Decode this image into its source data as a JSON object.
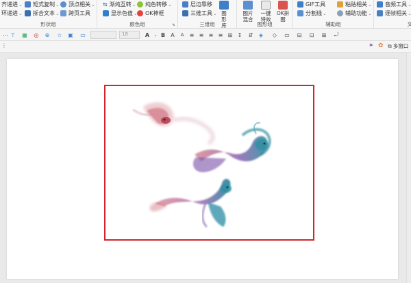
{
  "ribbon": {
    "shape_group": {
      "label": "形状组",
      "items": [
        "齐递进",
        "矩式复制",
        "顶点相关",
        "环递进",
        "拆合文本",
        "跨页工具"
      ]
    },
    "color_group": {
      "label": "颜色组",
      "items": [
        "渐纯互转",
        "纯色转移",
        "显示色值",
        "OK神框"
      ]
    },
    "threed_group": {
      "label": "三维组",
      "items": [
        "层边靠移",
        "三维工具"
      ],
      "big_button": "图形库"
    },
    "graphic_group": {
      "label": "图形组",
      "buttons": [
        "图片混合",
        "一键特效",
        "OK拼图"
      ]
    },
    "assist_group": {
      "label": "辅助组",
      "items": [
        "GIF工具",
        "粘贴相关",
        "分割线",
        "辅助功能"
      ]
    },
    "text_group": {
      "label": "文",
      "items": [
        "音频工具",
        "逐帧相关"
      ]
    }
  },
  "toolbar2": {
    "font_size": "18"
  },
  "tabrow": {
    "window_label": "多窗口"
  },
  "slide": {
    "picture_description": "ink-wash goldfish painting"
  },
  "colors": {
    "selection_border": "#d2242a",
    "fish_red": "#c2485a",
    "fish_teal": "#2f8fa0",
    "fish_purple": "#7a4fa8"
  }
}
